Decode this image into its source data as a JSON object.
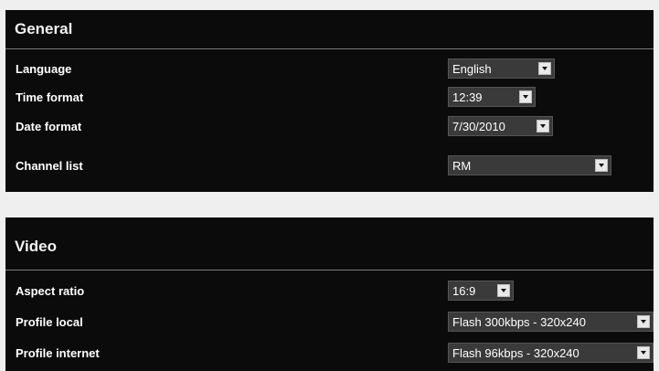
{
  "general": {
    "title": "General",
    "settings": [
      {
        "label": "Language",
        "value": "English"
      },
      {
        "label": "Time format",
        "value": "12:39"
      },
      {
        "label": "Date format",
        "value": "7/30/2010"
      },
      {
        "label": "Channel list",
        "value": "RM"
      }
    ]
  },
  "video": {
    "title": "Video",
    "settings": [
      {
        "label": "Aspect ratio",
        "value": "16:9"
      },
      {
        "label": "Profile local",
        "value": "Flash 300kbps - 320x240"
      },
      {
        "label": "Profile internet",
        "value": "Flash 96kbps - 320x240"
      }
    ]
  },
  "icons": {
    "dropdown_arrow": "chevron-down-icon"
  },
  "colors": {
    "panel_background": "#0b0b0b",
    "separator_band": "#efefef",
    "dropdown_background": "#3a3a3a",
    "arrow_button": "#e8e8e8",
    "text": "#ffffff"
  }
}
